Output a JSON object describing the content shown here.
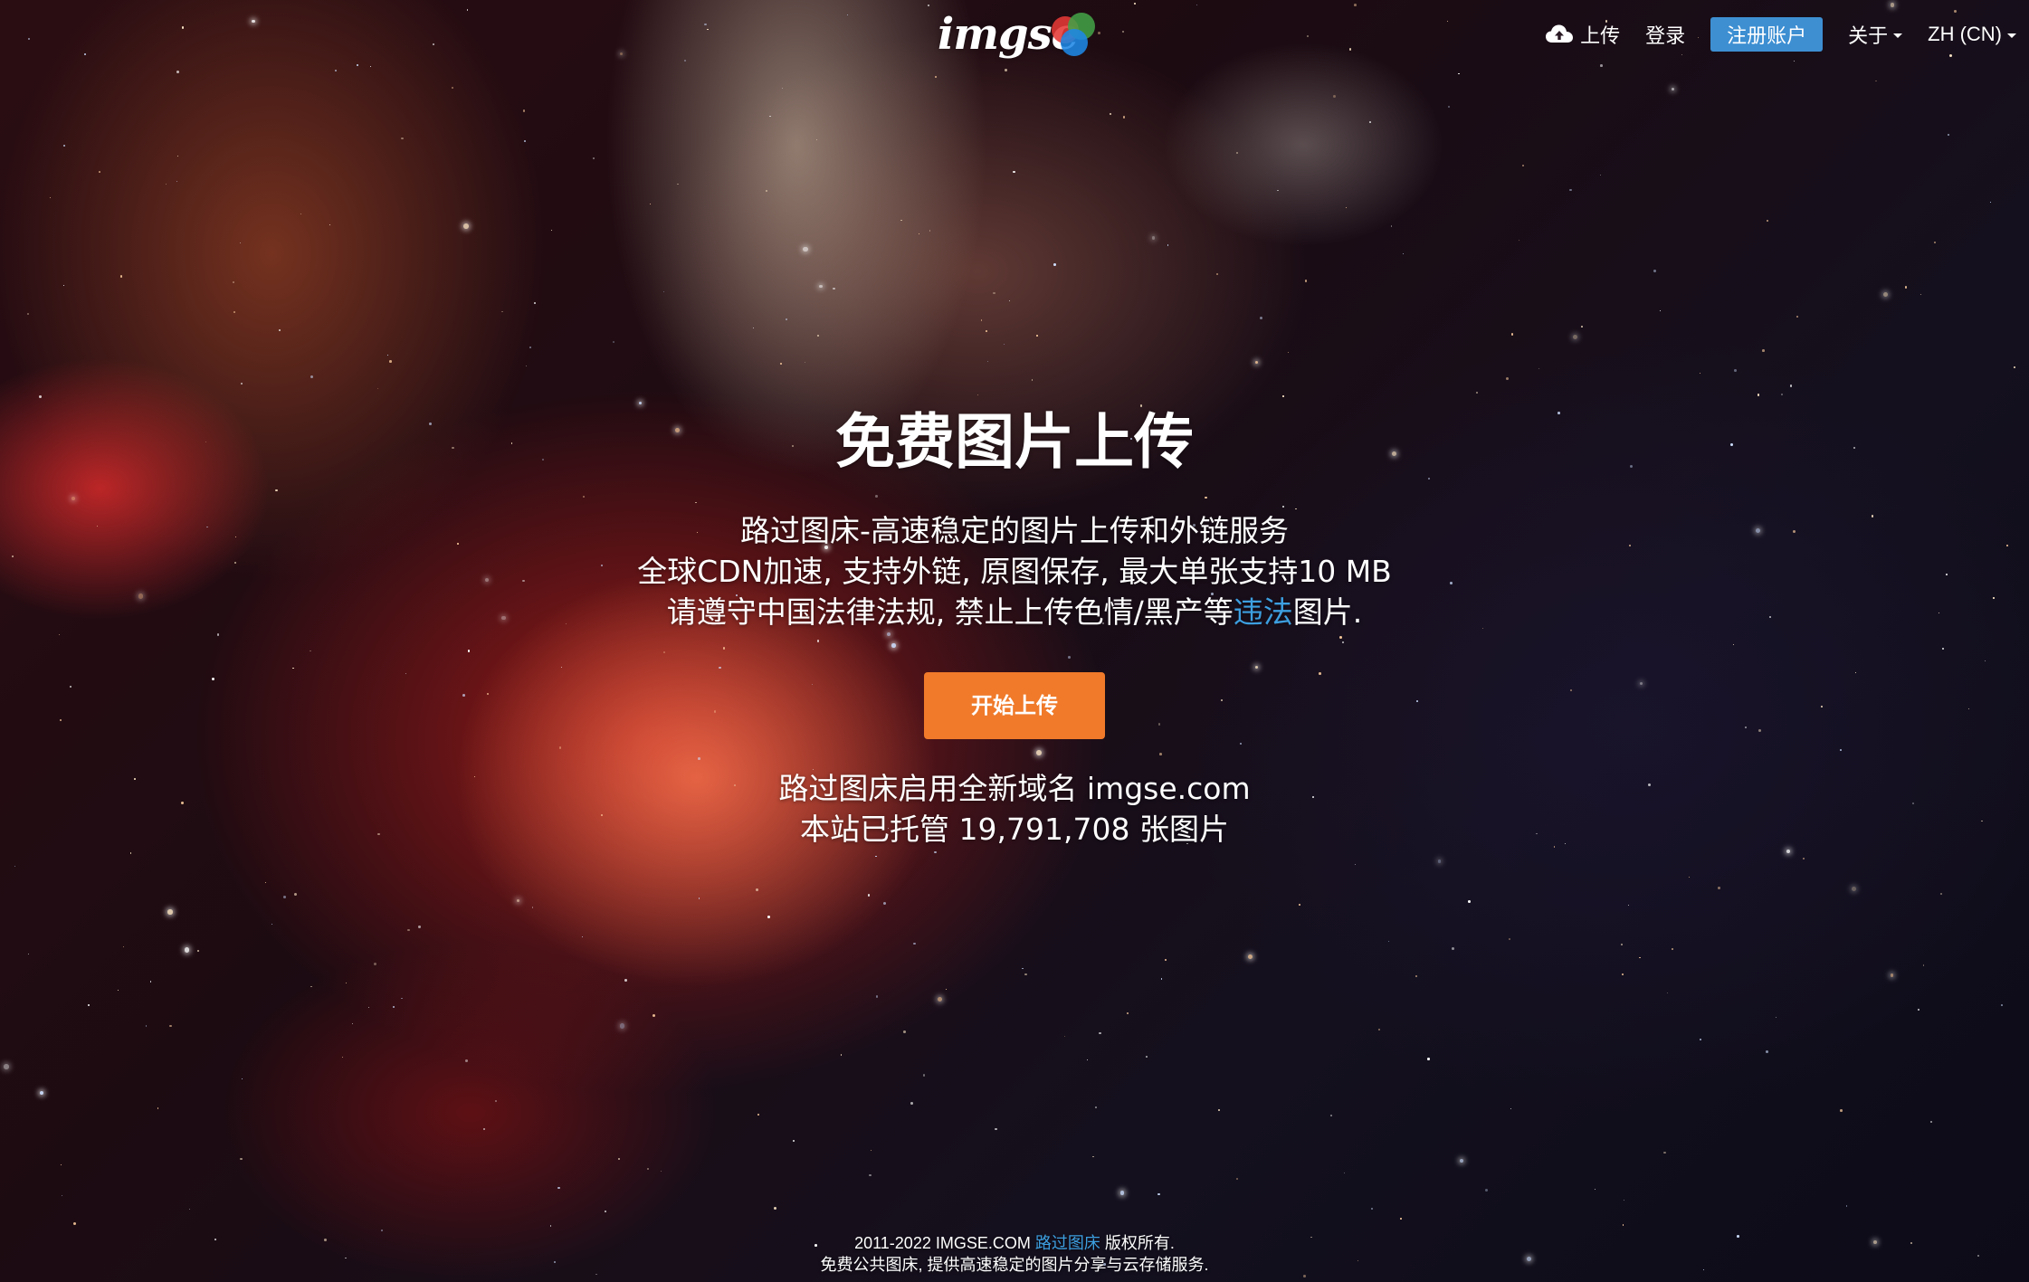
{
  "brand": {
    "logo_text": "imgse",
    "logo_colors": [
      "#e53935",
      "#43a047",
      "#1e88e5"
    ]
  },
  "nav": {
    "upload": {
      "label": "上传",
      "icon": "cloud-upload-icon"
    },
    "login": "登录",
    "register": "注册账户",
    "about": "关于",
    "language": "ZH (CN)"
  },
  "hero": {
    "title": "免费图片上传",
    "desc_line1": "路过图床-高速稳定的图片上传和外链服务",
    "desc_line2": "全球CDN加速, 支持外链, 原图保存, 最大单张支持10 MB",
    "desc_line3_prefix": "请遵守中国法律法规, 禁止上传色情/黑产等",
    "desc_line3_link": "违法",
    "desc_line3_suffix": "图片.",
    "start_button": "开始上传",
    "stats_line1": "路过图床启用全新域名 imgse.com",
    "stats_line2": "本站已托管 19,791,708 张图片"
  },
  "footer": {
    "line1_prefix": "2011-2022 IMGSE.COM",
    "line1_link": "路过图床",
    "line1_suffix": "版权所有.",
    "line2": "免费公共图床, 提供高速稳定的图片分享与云存储服务."
  },
  "colors": {
    "accent": "#f07a2a",
    "primary": "#3d8fd2",
    "link": "#3d9fe0"
  }
}
